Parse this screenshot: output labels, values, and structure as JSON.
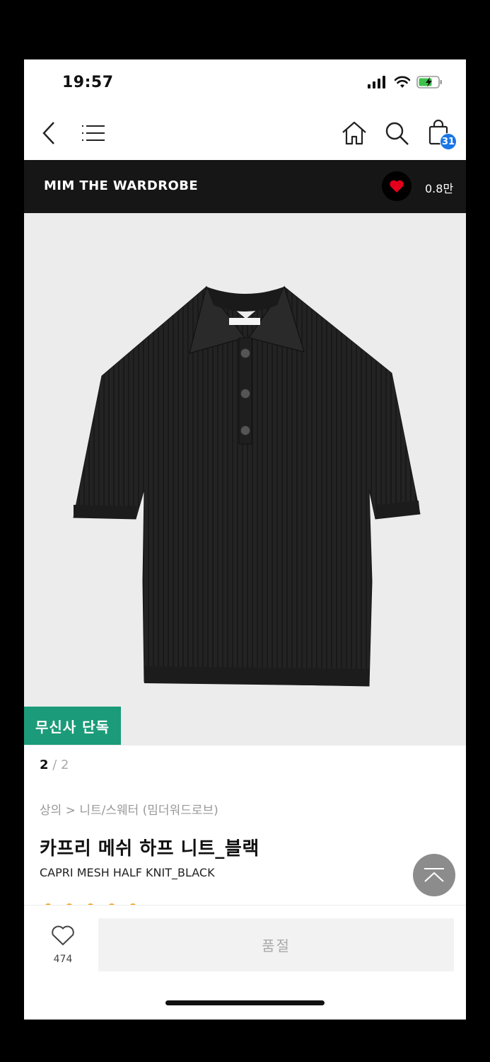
{
  "status": {
    "time": "19:57"
  },
  "nav": {
    "cart_count": "31"
  },
  "brand": {
    "name": "MIM THE WARDROBE",
    "likes": "0.8만"
  },
  "product": {
    "exclusive_badge": "무신사 단독",
    "pager_current": "2",
    "pager_total": " / 2",
    "breadcrumb": "상의 > 니트/스웨터 (밈더워드로브)",
    "title_ko": "카프리 메쉬 하프 니트_블랙",
    "title_en": "CAPRI MESH HALF KNIT_BLACK"
  },
  "bottom": {
    "like_count": "474",
    "buy_label": "품절"
  },
  "colors": {
    "brand_bar": "#161616",
    "badge_green": "#1b9b79",
    "cart_badge": "#1976e6",
    "heart_red": "#e4001b"
  }
}
